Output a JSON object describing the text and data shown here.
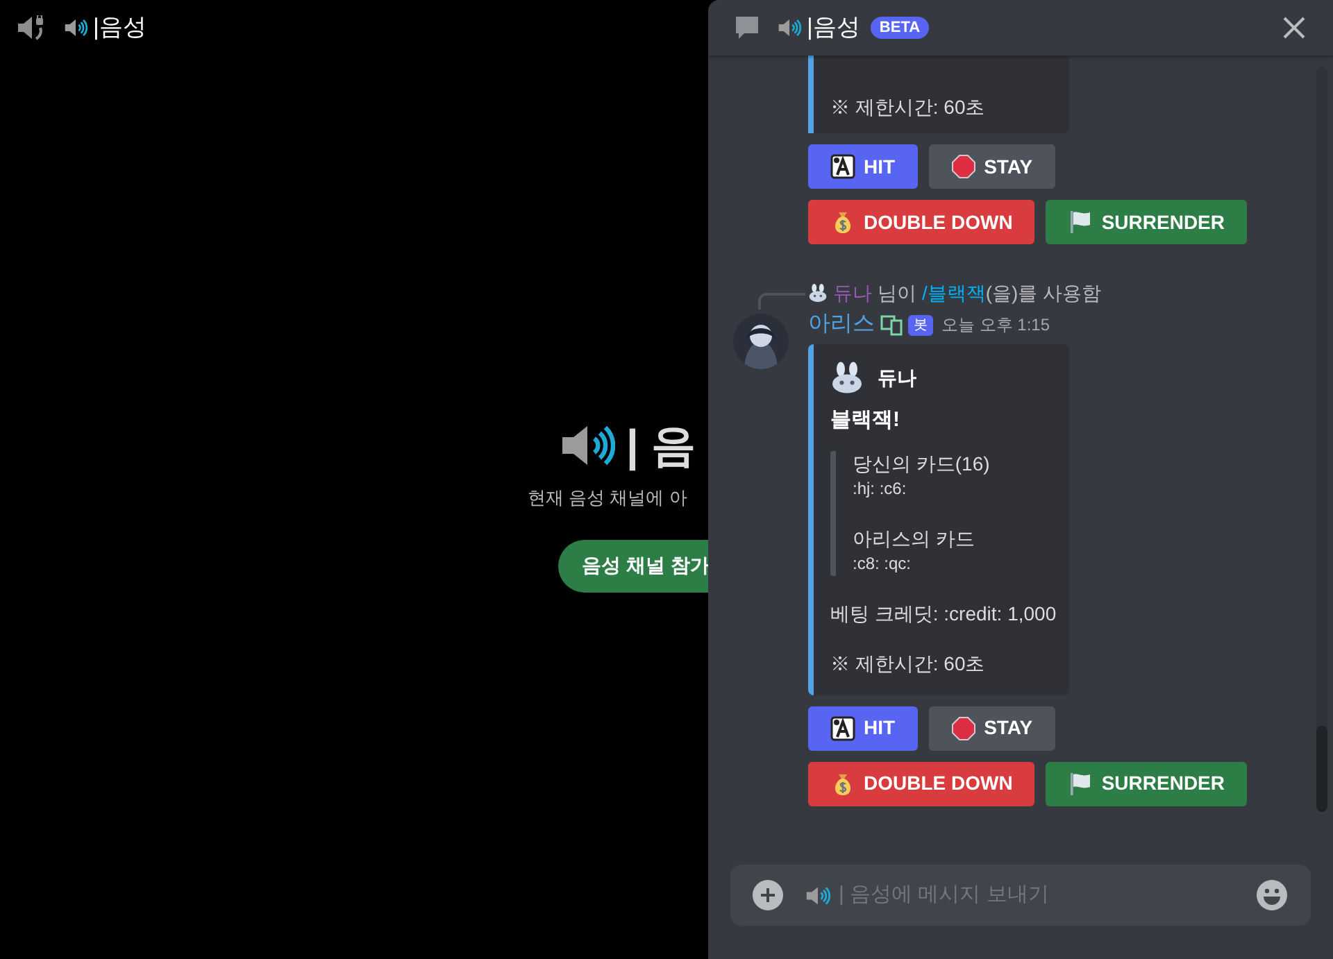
{
  "top_bar": {
    "title": "|음성"
  },
  "voice_stage": {
    "title": "| 음",
    "subtitle": "현재 음성 채널에 아",
    "join_button": "음성 채널 참가"
  },
  "chat_panel": {
    "title": "|음성",
    "badge": "BETA"
  },
  "previous_message": {
    "embed_lines": [
      "※ 제한시간: 60초"
    ],
    "buttons": [
      {
        "label": "HIT"
      },
      {
        "label": "STAY"
      },
      {
        "label": "DOUBLE DOWN"
      },
      {
        "label": "SURRENDER"
      }
    ]
  },
  "message": {
    "reply": {
      "user": "듀나",
      "text": "님이",
      "command": "/블랙잭",
      "suffix": "(을)를 사용함"
    },
    "author": "아리스",
    "bot_tag": "봇",
    "time": "오늘 오후 1:15",
    "embed": {
      "author": "듀나",
      "title": "블랙잭!",
      "quote": [
        {
          "title": "당신의 카드(16)",
          "value": ":hj: :c6:"
        },
        {
          "title": "아리스의 카드",
          "value": ":c8: :qc:"
        }
      ],
      "lines": [
        "베팅 크레딧: :credit: 1,000",
        "※ 제한시간: 60초"
      ]
    },
    "buttons": [
      {
        "label": "HIT"
      },
      {
        "label": "STAY"
      },
      {
        "label": "DOUBLE DOWN"
      },
      {
        "label": "SURRENDER"
      }
    ]
  },
  "composer": {
    "placeholder": "| 음성에 메시지 보내기"
  }
}
